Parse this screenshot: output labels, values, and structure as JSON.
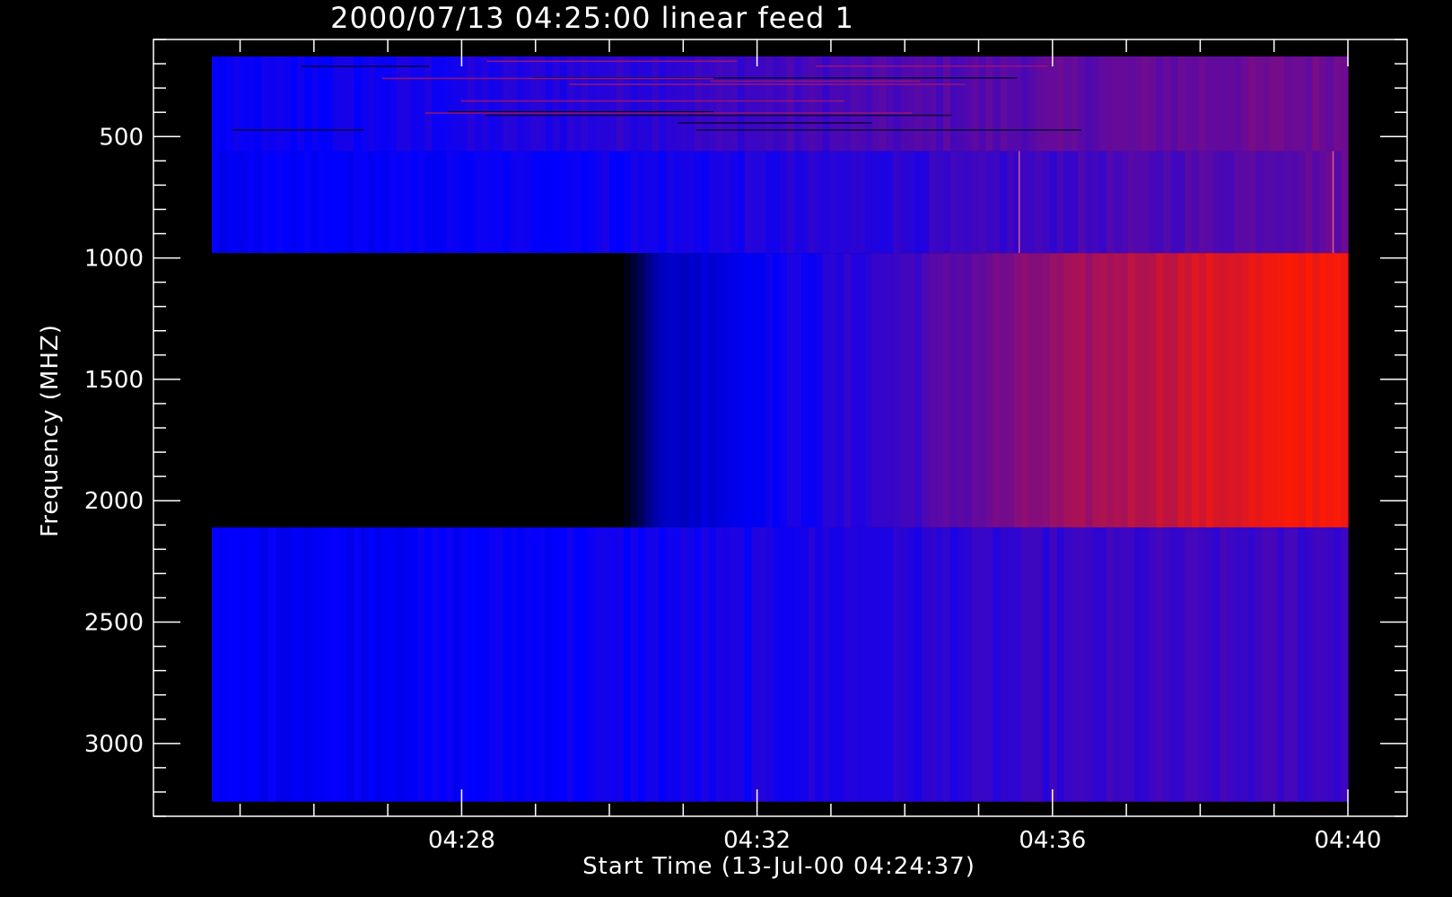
{
  "chart_data": {
    "type": "heatmap",
    "title": "2000/07/13 04:25:00 linear feed 1",
    "xlabel": "Start Time (13-Jul-00 04:24:37)",
    "ylabel": "Frequency (MHZ)",
    "x_range_minutes": [
      4.617,
      20.0
    ],
    "x_data_extent_minutes": [
      4.617,
      20.0
    ],
    "x_major_ticks": [
      {
        "minute": 8,
        "label": "04:28"
      },
      {
        "minute": 12,
        "label": "04:32"
      },
      {
        "minute": 16,
        "label": "04:36"
      },
      {
        "minute": 20,
        "label": "04:40"
      }
    ],
    "x_minor_step_minutes": 1,
    "y_reversed": true,
    "ylim": [
      3300,
      100
    ],
    "y_major_ticks": [
      500,
      1000,
      1500,
      2000,
      2500,
      3000
    ],
    "y_minor_step": 100,
    "colormap": "black-blue-red",
    "colors": {
      "low": "#000000",
      "mid": "#0000ff",
      "high": "#ff1a00",
      "axes": "#ffffff",
      "background": "#000000"
    },
    "bands": [
      {
        "name": "band 1",
        "freq_range_mhz": [
          170,
          560
        ],
        "description": "noisy band with narrow horizontal RFI lines",
        "intensity_profile": [
          [
            4.617,
            0.5
          ],
          [
            8.4,
            0.55
          ],
          [
            12,
            0.62
          ],
          [
            16,
            0.68
          ],
          [
            20,
            0.72
          ]
        ]
      },
      {
        "name": "band 2",
        "freq_range_mhz": [
          560,
          980
        ],
        "intensity_profile": [
          [
            4.617,
            0.48
          ],
          [
            8,
            0.5
          ],
          [
            12,
            0.55
          ],
          [
            16,
            0.62
          ],
          [
            20,
            0.7
          ]
        ]
      },
      {
        "name": "band 3",
        "freq_range_mhz": [
          980,
          2110
        ],
        "intensity_profile": [
          [
            4.617,
            0.0
          ],
          [
            10.2,
            0.0
          ],
          [
            10.6,
            0.35
          ],
          [
            12,
            0.5
          ],
          [
            14,
            0.62
          ],
          [
            16,
            0.78
          ],
          [
            18,
            0.92
          ],
          [
            20,
            1.0
          ]
        ]
      },
      {
        "name": "band 4",
        "freq_range_mhz": [
          2110,
          3240
        ],
        "intensity_profile": [
          [
            4.617,
            0.48
          ],
          [
            8,
            0.5
          ],
          [
            12,
            0.54
          ],
          [
            16,
            0.6
          ],
          [
            20,
            0.62
          ]
        ]
      }
    ],
    "features": [
      {
        "type": "vertical_spike",
        "minute": 15.55,
        "freq_range_mhz": [
          560,
          980
        ]
      },
      {
        "type": "vertical_spike",
        "minute": 19.8,
        "freq_range_mhz": [
          560,
          980
        ]
      }
    ]
  }
}
